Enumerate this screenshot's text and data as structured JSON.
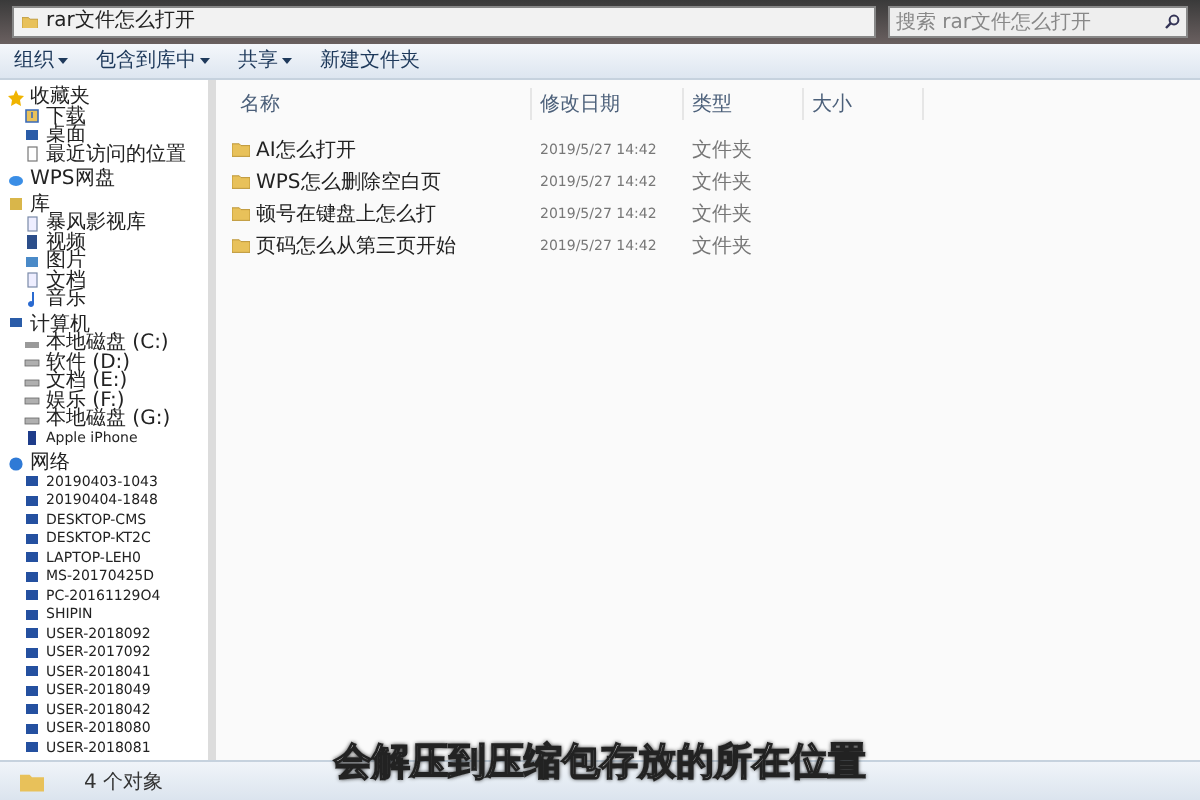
{
  "address_bar": {
    "path": "rar文件怎么打开"
  },
  "search": {
    "placeholder": "搜索 rar文件怎么打开"
  },
  "toolbar": {
    "buttons": [
      {
        "label": "组织",
        "dropdown": true
      },
      {
        "label": "包含到库中",
        "dropdown": true
      },
      {
        "label": "共享",
        "dropdown": true
      },
      {
        "label": "新建文件夹",
        "dropdown": false
      }
    ]
  },
  "sidebar": {
    "groups": [
      {
        "label": "收藏夹",
        "kind": "favorites",
        "children": [
          {
            "label": "下载",
            "kind": "download"
          },
          {
            "label": "桌面",
            "kind": "desktop"
          },
          {
            "label": "最近访问的位置",
            "kind": "recent"
          }
        ]
      },
      {
        "label": "WPS网盘",
        "kind": "cloud"
      },
      {
        "label": "库",
        "kind": "library",
        "children": [
          {
            "label": "暴风影视库",
            "kind": "doc"
          },
          {
            "label": "视频",
            "kind": "video"
          },
          {
            "label": "图片",
            "kind": "picture"
          },
          {
            "label": "文档",
            "kind": "doc"
          },
          {
            "label": "音乐",
            "kind": "music"
          }
        ]
      },
      {
        "label": "计算机",
        "kind": "computer",
        "children": [
          {
            "label": "本地磁盘 (C:)",
            "kind": "system-drive"
          },
          {
            "label": "软件 (D:)",
            "kind": "drive"
          },
          {
            "label": "文档 (E:)",
            "kind": "drive"
          },
          {
            "label": "娱乐 (F:)",
            "kind": "drive"
          },
          {
            "label": "本地磁盘 (G:)",
            "kind": "drive"
          },
          {
            "label": "Apple iPhone",
            "kind": "device"
          }
        ]
      },
      {
        "label": "网络",
        "kind": "network",
        "children": [
          {
            "label": "20190403-1043",
            "kind": "pc"
          },
          {
            "label": "20190404-1848",
            "kind": "pc"
          },
          {
            "label": "DESKTOP-CMS",
            "kind": "pc"
          },
          {
            "label": "DESKTOP-KT2C",
            "kind": "pc"
          },
          {
            "label": "LAPTOP-LEH0",
            "kind": "pc"
          },
          {
            "label": "MS-20170425D",
            "kind": "pc"
          },
          {
            "label": "PC-20161129O4",
            "kind": "pc"
          },
          {
            "label": "SHIPIN",
            "kind": "pc"
          },
          {
            "label": "USER-2018092",
            "kind": "pc"
          },
          {
            "label": "USER-2017092",
            "kind": "pc"
          },
          {
            "label": "USER-2018041",
            "kind": "pc"
          },
          {
            "label": "USER-2018049",
            "kind": "pc"
          },
          {
            "label": "USER-2018042",
            "kind": "pc"
          },
          {
            "label": "USER-2018080",
            "kind": "pc"
          },
          {
            "label": "USER-2018081",
            "kind": "pc"
          }
        ]
      }
    ]
  },
  "table": {
    "columns": [
      "名称",
      "修改日期",
      "类型",
      "大小"
    ],
    "rows": [
      {
        "name": "AI怎么打开",
        "modified": "2019/5/27 14:42",
        "type": "文件夹"
      },
      {
        "name": "WPS怎么删除空白页",
        "modified": "2019/5/27 14:42",
        "type": "文件夹"
      },
      {
        "name": "顿号在键盘上怎么打",
        "modified": "2019/5/27 14:42",
        "type": "文件夹"
      },
      {
        "name": "页码怎么从第三页开始",
        "modified": "2019/5/27 14:42",
        "type": "文件夹"
      }
    ]
  },
  "status_bar": {
    "count": "4 个对象"
  },
  "subtitle": "会解压到压缩包存放的所在位置"
}
